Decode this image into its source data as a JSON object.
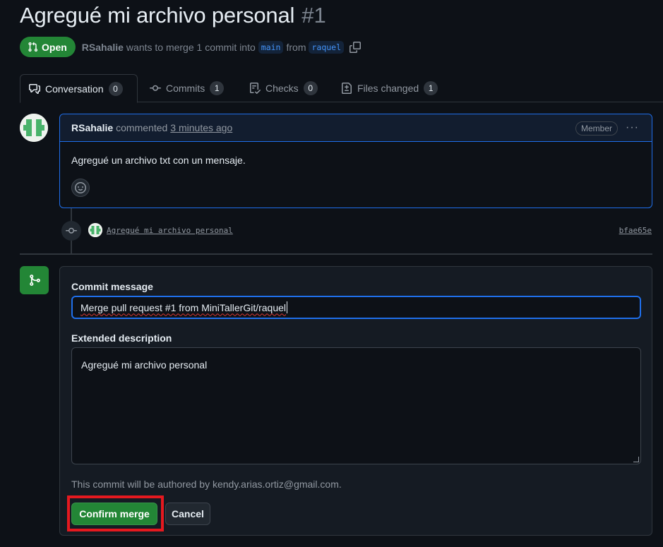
{
  "header": {
    "title": "Agregué mi archivo personal",
    "number": "#1",
    "state": "Open",
    "author": "RSahalie",
    "merge_text": "wants to merge 1 commit into",
    "base_branch": "main",
    "from_text": "from",
    "head_branch": "raquel"
  },
  "tabs": [
    {
      "label": "Conversation",
      "count": "0",
      "icon": "comment-discussion-icon"
    },
    {
      "label": "Commits",
      "count": "1",
      "icon": "git-commit-icon"
    },
    {
      "label": "Checks",
      "count": "0",
      "icon": "checklist-icon"
    },
    {
      "label": "Files changed",
      "count": "1",
      "icon": "file-diff-icon"
    }
  ],
  "comment": {
    "author": "RSahalie",
    "verb": "commented",
    "time": "3 minutes ago",
    "role_badge": "Member",
    "more_label": "···",
    "body": "Agregué un archivo txt con un mensaje."
  },
  "commit": {
    "message": "Agregué mi archivo personal",
    "sha": "bfae65e"
  },
  "merge_form": {
    "commit_message_label": "Commit message",
    "commit_message_value": "Merge pull request #1 from MiniTallerGit/raquel",
    "extended_description_label": "Extended description",
    "extended_description_value": "Agregué mi archivo personal",
    "author_note": "This commit will be authored by kendy.arias.ortiz@gmail.com.",
    "confirm_label": "Confirm merge",
    "cancel_label": "Cancel"
  },
  "colors": {
    "background": "#0d1117",
    "accent_blue": "#1f6feb",
    "merge_green": "#238636",
    "annotation_red": "#e5191f"
  }
}
